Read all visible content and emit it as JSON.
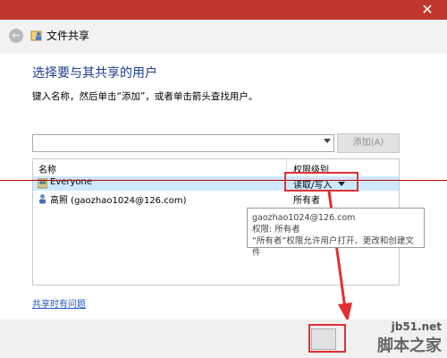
{
  "window": {
    "title": "文件共享",
    "close_glyph": "✕"
  },
  "header": {
    "heading": "选择要与其共享的用户",
    "instructions": "键入名称，然后单击“添加”，或者单击箭头查找用户。"
  },
  "input": {
    "value": "",
    "add_button": "添加(A)"
  },
  "table": {
    "columns": [
      "名称",
      "权限级别"
    ],
    "rows": [
      {
        "name": "Everyone",
        "permission": "读取/写入",
        "selected": true,
        "icon": "group-icon"
      },
      {
        "name": "高照 (gaozhao1024@126.com)",
        "permission": "所有者",
        "selected": false,
        "icon": "user-icon"
      }
    ]
  },
  "tooltip": {
    "line1": "gaozhao1024@126.com",
    "line2": "权限: 所有者",
    "line3": "“所有者”权限允许用户打开、更改和创建文件"
  },
  "footer": {
    "help_link": "共享时有问题"
  },
  "watermark": {
    "site": "jb51.net",
    "brand": "脚本之家"
  },
  "colors": {
    "titlebar": "#c0362c",
    "heading": "#1e3d8f",
    "highlight": "#e03030",
    "selection": "#cde8ff",
    "link": "#1e5ac8"
  }
}
